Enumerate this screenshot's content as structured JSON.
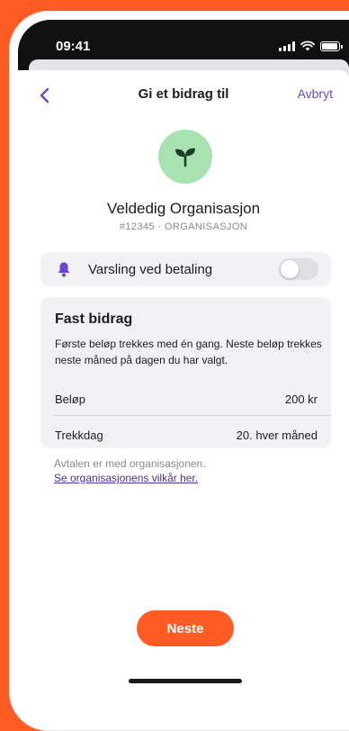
{
  "status": {
    "time": "09:41"
  },
  "nav": {
    "title": "Gi et bidrag til",
    "cancel_label": "Avbryt"
  },
  "organization": {
    "name": "Veldedig Organisasjon",
    "meta": "#12345 · ORGANISASJON",
    "icon": "sprout-icon"
  },
  "notification": {
    "label": "Varsling ved betaling",
    "enabled": false
  },
  "fixed_donation": {
    "title": "Fast bidrag",
    "description": "Første beløp trekkes med én gang. Neste beløp trekkes neste måned på dagen du har valgt.",
    "amount_label": "Beløp",
    "amount_value": "200 kr",
    "day_label": "Trekkdag",
    "day_value": "20. hver måned"
  },
  "terms": {
    "text": "Avtalen er med organisasjonen.",
    "link": "Se organisasjonens vilkår her."
  },
  "actions": {
    "next_label": "Neste"
  },
  "colors": {
    "accent": "#ff5b23",
    "purple": "#6b46d6",
    "avatar_bg": "#a6e3b1",
    "sprout": "#1e3b2a"
  }
}
